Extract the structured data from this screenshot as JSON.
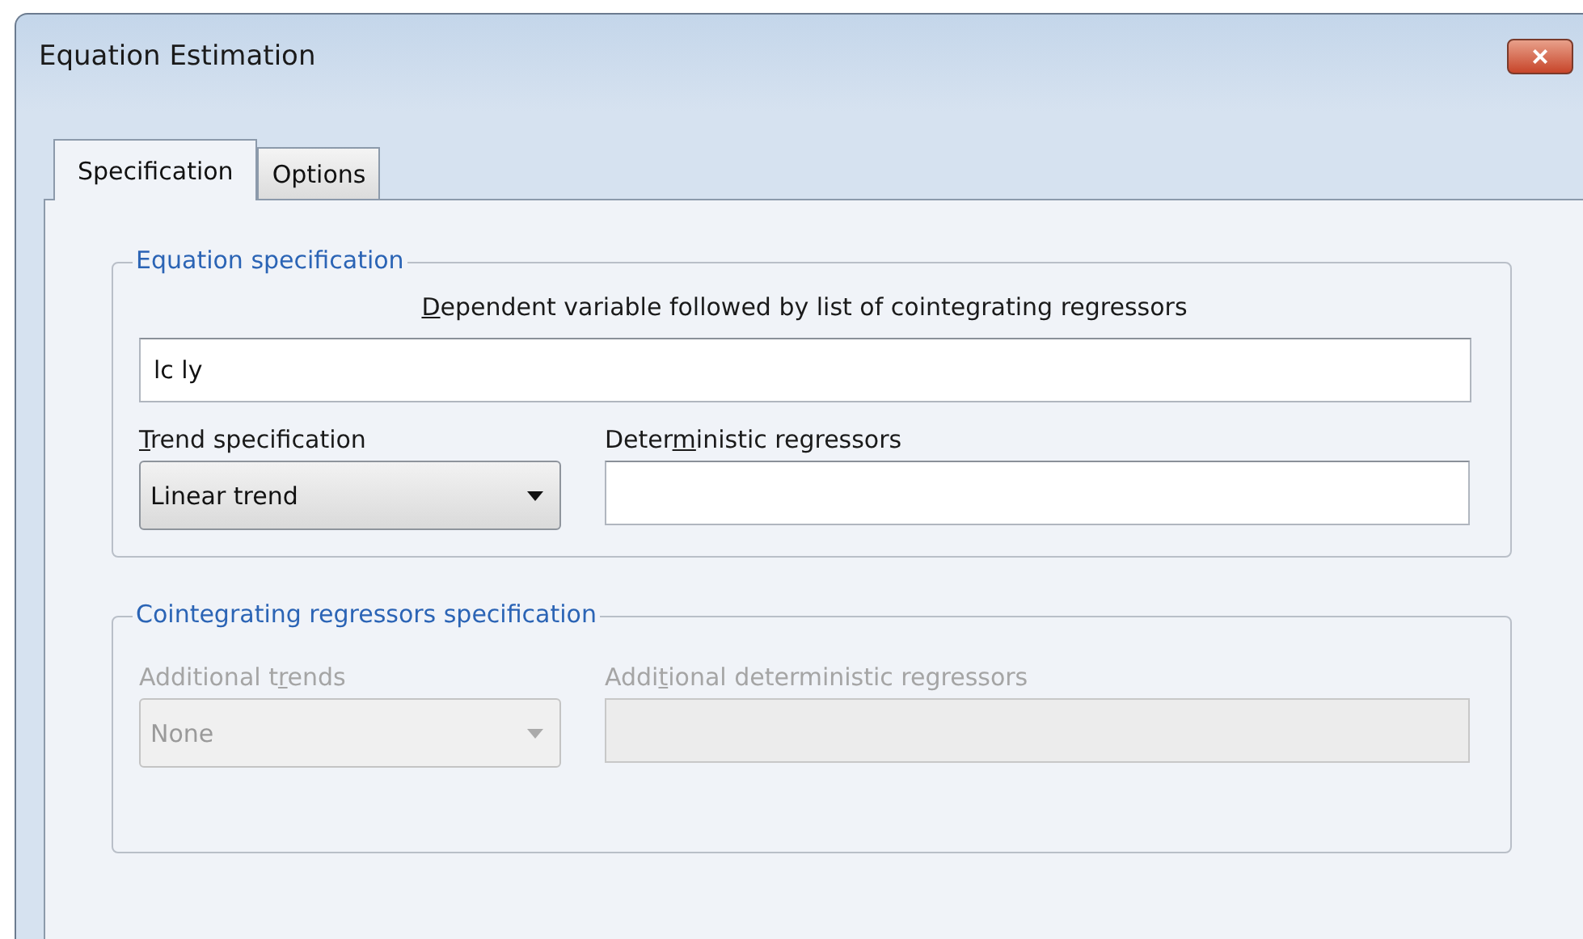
{
  "window": {
    "title": "Equation Estimation",
    "close": "×"
  },
  "tabs": [
    {
      "label": "Specification",
      "selected": true
    },
    {
      "label": "Options",
      "selected": false
    }
  ],
  "groups": [
    {
      "legend": "Equation specification",
      "disabled": false,
      "list_field": {
        "label": {
          "key": "D",
          "after": "ependent variable followed by list of cointegrating regressors"
        },
        "value": "lc ly"
      },
      "combo": {
        "label": {
          "key": "T",
          "after": "rend specification"
        },
        "value": "Linear trend"
      },
      "text_field": {
        "label": {
          "before": "Deter",
          "key": "m",
          "after": "inistic regressors"
        }
      }
    },
    {
      "legend": "Cointegrating regressors specification",
      "disabled": true,
      "combo": {
        "label": {
          "before": "Additional t",
          "key": "r",
          "after": "ends"
        },
        "value": "None"
      },
      "text_field": {
        "label": {
          "before": "Addi",
          "key": "t",
          "after": "ional deterministic regressors"
        }
      }
    }
  ]
}
